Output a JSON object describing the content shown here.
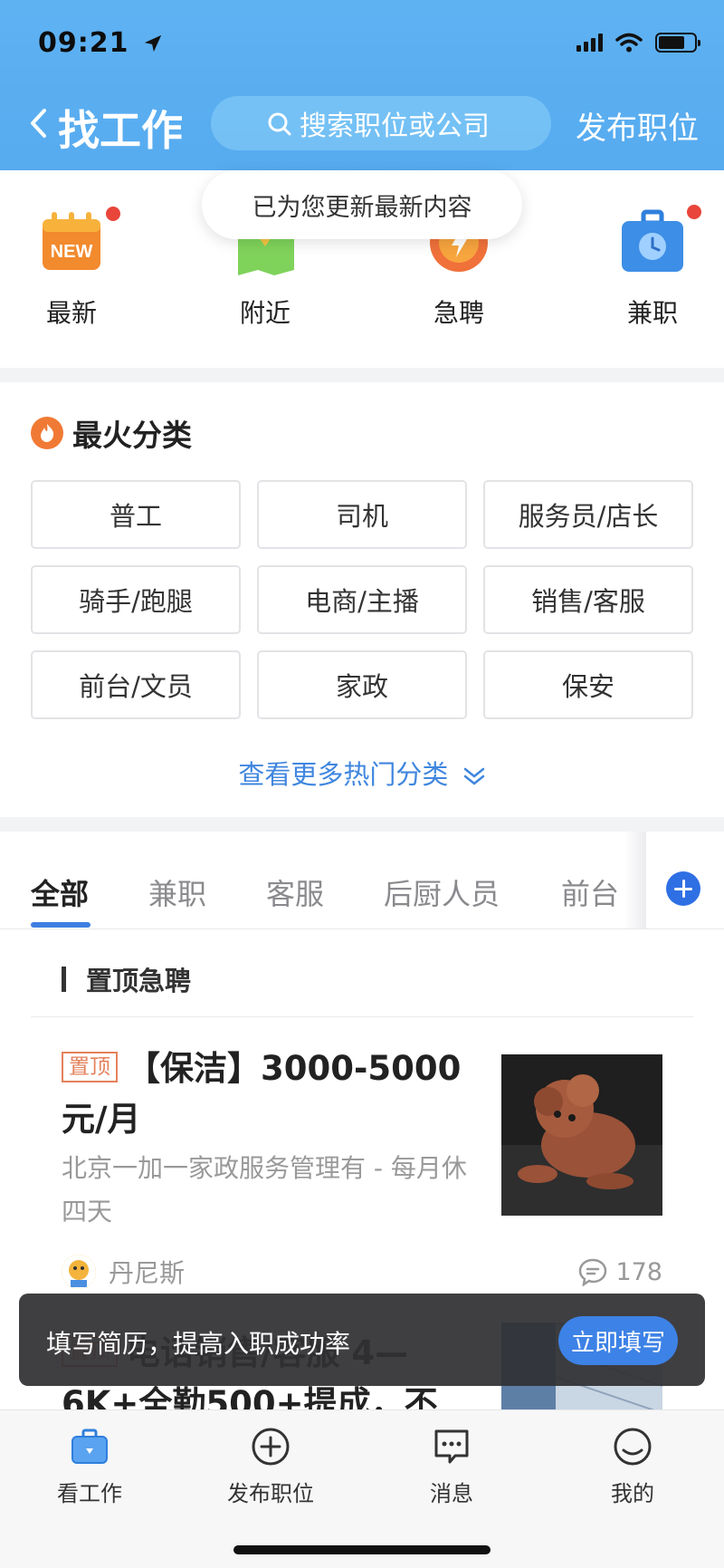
{
  "status_bar": {
    "time": "09:21"
  },
  "nav": {
    "title": "找工作",
    "search_placeholder": "搜索职位或公司",
    "publish": "发布职位"
  },
  "refresh_toast": "已为您更新最新内容",
  "quick_categories": [
    {
      "label": "最新",
      "icon": "new-calendar-icon",
      "dot": true
    },
    {
      "label": "附近",
      "icon": "map-pin-icon",
      "dot": false
    },
    {
      "label": "急聘",
      "icon": "lightning-badge-icon",
      "dot": false
    },
    {
      "label": "兼职",
      "icon": "briefcase-clock-icon",
      "dot": true
    }
  ],
  "hot": {
    "title": "最火分类",
    "categories": [
      "普工",
      "司机",
      "服务员/店长",
      "骑手/跑腿",
      "电商/主播",
      "销售/客服",
      "前台/文员",
      "家政",
      "保安"
    ],
    "more": "查看更多热门分类"
  },
  "tabs": [
    "全部",
    "兼职",
    "客服",
    "后厨人员",
    "前台"
  ],
  "list": {
    "section_title": "置顶急聘",
    "jobs": [
      {
        "pin": "置顶",
        "title": "【保洁】3000-5000元/月",
        "subtitle": "北京一加一家政服务管理有 - 每月休四天",
        "poster": "丹尼斯",
        "comments": "178"
      },
      {
        "pin": "置顶",
        "title": "电话销售/客服 4—6K+全勤500+提成，不"
      }
    ]
  },
  "resume_toast": {
    "text": "填写简历，提高入职成功率",
    "button": "立即填写"
  },
  "bottom_tabs": [
    {
      "label": "看工作",
      "icon": "briefcase-icon",
      "active": true
    },
    {
      "label": "发布职位",
      "icon": "plus-circle-icon",
      "active": false
    },
    {
      "label": "消息",
      "icon": "message-icon",
      "active": false
    },
    {
      "label": "我的",
      "icon": "profile-icon",
      "active": false
    }
  ]
}
